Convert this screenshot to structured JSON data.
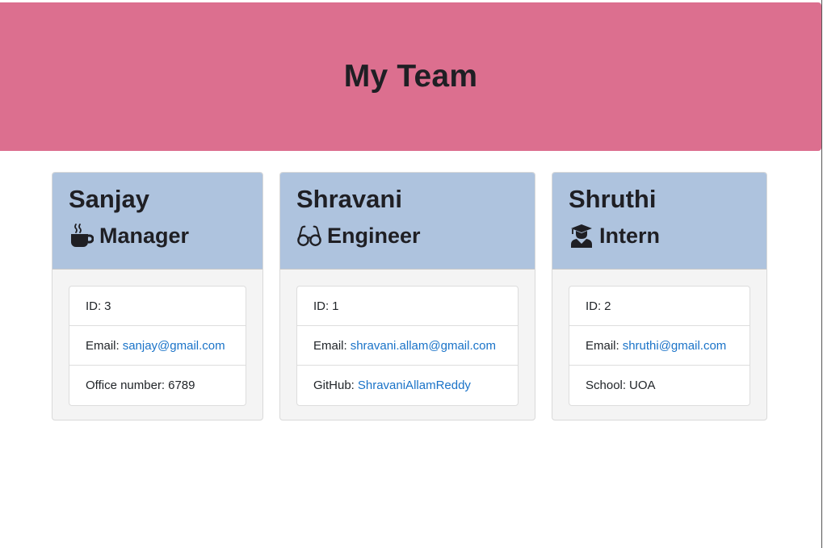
{
  "header": {
    "title": "My Team"
  },
  "team": [
    {
      "name": "Sanjay",
      "role": "Manager",
      "icon": "coffee-icon",
      "id_label": "ID:",
      "id": "3",
      "email_label": "Email:",
      "email": "sanjay@gmail.com",
      "extra_label": "Office number:",
      "extra_value": "6789"
    },
    {
      "name": "Shravani",
      "role": "Engineer",
      "icon": "glasses-icon",
      "id_label": "ID:",
      "id": "1",
      "email_label": "Email:",
      "email": "shravani.allam@gmail.com",
      "extra_label": "GitHub:",
      "extra_value": "ShravaniAllamReddy"
    },
    {
      "name": "Shruthi",
      "role": "Intern",
      "icon": "graduate-icon",
      "id_label": "ID:",
      "id": "2",
      "email_label": "Email:",
      "email": "shruthi@gmail.com",
      "extra_label": "School:",
      "extra_value": "UOA"
    }
  ],
  "colors": {
    "header_bg": "#dc6f8f",
    "card_header_bg": "#aec3de",
    "card_bg": "#f4f4f4",
    "link": "#1a73c8"
  }
}
